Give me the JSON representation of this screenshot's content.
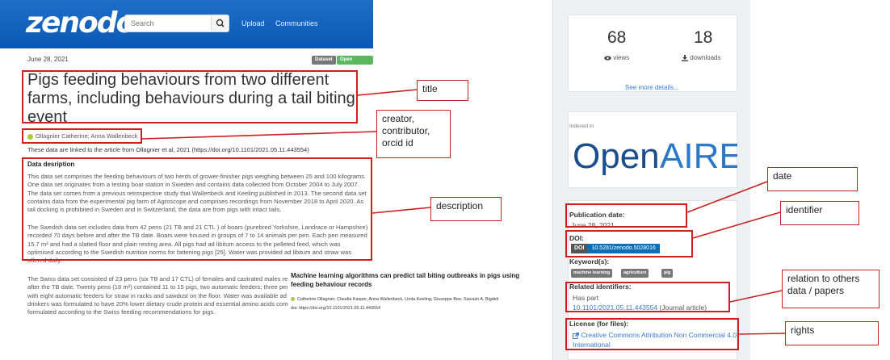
{
  "zenodo": {
    "logo": "zenodo",
    "search_placeholder": "Search",
    "nav": [
      "Upload",
      "Communities"
    ],
    "date": "June 28, 2021",
    "badges": [
      "Dataset",
      "Open Access"
    ],
    "badge_colors": [
      "#777777",
      "#5cb85c"
    ],
    "title": "Pigs feeding behaviours from two different farms, including behaviours during a tail biting event",
    "creators": "Ollagnier Catherine; Anna Wallenbeck",
    "linked": "These data are linked to the article from Ollagnier et al, 2021 (https://doi.org/10.1101/2021.05.11.443554)",
    "description_heading": "Data desription",
    "paragraphs": [
      "This data set comprises the feeding behaviours of two herds of grower-finisher pigs weighing between 25 and 100 kilograms. One data set originates from a testing boar station in Sweden and contains data collected from October 2004 to July 2007. The data set comes from a previous retrospective study that Wallenbeck and Keeling published in 2013. The second data set contains data from the experimental pig farm of Agroscope and comprises recordings from November 2018 to April 2020. As tail docking is prohibited in Sweden and in Switzerland, the data are from pigs with intact tails.",
      "The Swedish data set includes data from 42 pens (21 TB and 21 CTL ) of boars (purebred Yorkshire, Landrace or Hampshire) recorded 70 days before and after the TB date. Boars were housed in groups of 7 to 14 animals per pen. Each pen measured 15.7 m² and had a slatted floor and plain resting area. All pigs had ad libitum access to the pelleted feed, which was optimised according to the Swedish nutrition norms for fattening pigs [25]. Water was provided ad libitum and straw was offered daily.",
      "The Swiss data set consisted of 23 pens (six TB and 17 CTL) of females and castrated males recorded 100 days before and after the TB date. Twenty pens (18 m²) contained 11 to 15 pigs, two automatic feeders; three pens (78 m²) were equipped with eight automatic feeders for straw in racks and sawdust on the floor. Water was available ad libitum through nipple drinkers was formulated to have 20% lower dietary crude protein and essential amino acids compared to a standard diet formulated according to the Swiss feeding recommendations for pigs."
    ],
    "paper": {
      "title": "Machine learning algorithms can predict tail biting outbreaks in pigs using feeding behaviour records",
      "authors": "Catherine Ollagnier, Claudia Kasper, Anna Wallenbeck, Linda Keeling, Giuseppe Bee, Siavash A. Bigdeli",
      "doi": "doi: https://doi.org/10.1101/2021.05.11.443554"
    },
    "sidebar": {
      "views_count": "68",
      "views_label": "views",
      "downloads_count": "18",
      "downloads_label": "downloads",
      "see_more": "See more details...",
      "indexed_in": "Indexed in",
      "openaire": "OpenAIRE",
      "publication_date_label": "Publication date:",
      "publication_date": "June 28, 2021",
      "doi_label": "DOI:",
      "doi_tag": "DOI",
      "doi": "10.5281/zenodo.5028016",
      "keywords_label": "Keyword(s):",
      "keywords": [
        "machine learning",
        "agriculture",
        "pig"
      ],
      "related_label": "Related identifiers:",
      "related_type": "Has part",
      "related_id": "10.1101/2021.05.11.443554",
      "related_note": "(Journal article)",
      "license_label": "License (for files):",
      "license": "Creative Commons Attribution Non Commercial 4.0 International"
    }
  },
  "annotations": [
    "title",
    "creator, contributor, orcid id",
    "description",
    "date",
    "identifier",
    "relation to others data / papers",
    "rights"
  ],
  "annotation_color": "#cc1f1f"
}
